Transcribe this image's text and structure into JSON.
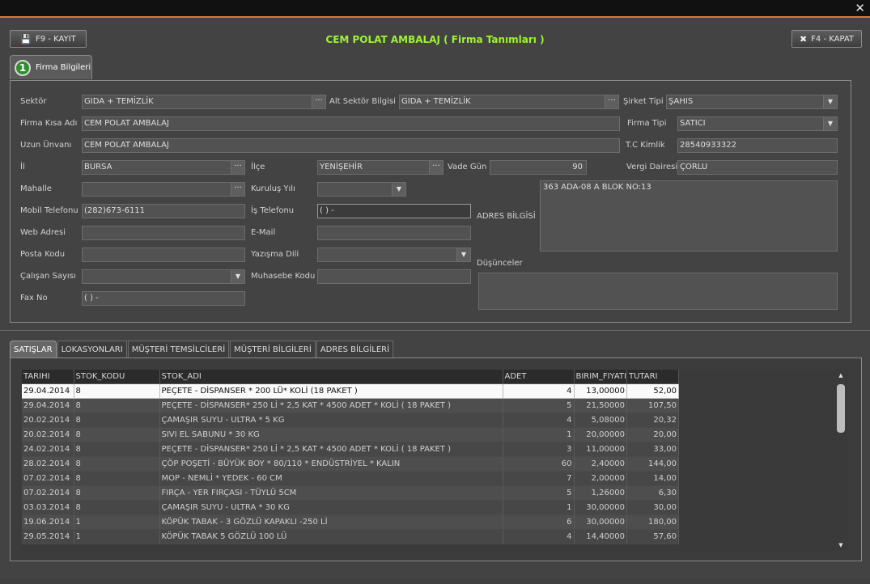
{
  "window": {
    "close_glyph": "✕"
  },
  "header": {
    "title": "CEM POLAT AMBALAJ  ( Firma Tanımları )",
    "save_label": "F9 - KAYIT",
    "close_label": "F4 - KAPAT",
    "tab_number": "1",
    "tab_label": "Firma Bilgileri"
  },
  "form": {
    "sektor_label": "Sektör",
    "sektor": "GIDA + TEMİZLİK",
    "alt_sektor_label": "Alt Sektör Bilgisi",
    "alt_sektor": "GIDA + TEMİZLİK",
    "sirket_tipi_label": "Şirket Tipi",
    "sirket_tipi": "ŞAHIS",
    "firma_kisa_label": "Firma Kısa Adı",
    "firma_kisa": "CEM POLAT AMBALAJ",
    "firma_tipi_label": "Firma Tipi",
    "firma_tipi": "SATICI",
    "uzun_unvan_label": "Uzun Ünvanı",
    "uzun_unvan": "CEM POLAT AMBALAJ",
    "tc_label": "T.C Kimlik",
    "tc": "28540933322",
    "il_label": "İl",
    "il": "BURSA",
    "ilce_label": "İlçe",
    "ilce": "YENİŞEHİR",
    "vade_label": "Vade Gün",
    "vade": "90",
    "vergi_label": "Vergi Dairesi",
    "vergi": "ÇORLU",
    "mahalle_label": "Mahalle",
    "mahalle": "",
    "kurulus_label": "Kuruluş Yılı",
    "kurulus": "",
    "mobil_label": "Mobil Telefonu",
    "mobil": "(282)673-6111",
    "is_tel_label": "İş Telefonu",
    "is_tel": "(   )    -",
    "adres_label": "ADRES BİLGİSİ",
    "adres": "363 ADA-08 A BLOK NO:13",
    "web_label": "Web Adresi",
    "web": "",
    "email_label": "E-Mail",
    "email": "",
    "posta_label": "Posta Kodu",
    "posta": "",
    "yazisma_label": "Yazışma Dili",
    "yazisma": "",
    "dusunce_label": "Düşünceler",
    "dusunce": "",
    "calisan_label": "Çalışan Sayısı",
    "calisan": "",
    "muhasebe_label": "Muhasebe Kodu",
    "muhasebe": "",
    "fax_label": "Fax No",
    "fax": "(   )    -"
  },
  "tabs": [
    "SATIŞLAR",
    "LOKASYONLARI",
    "MÜŞTERİ TEMSİLCİLERİ",
    "MÜŞTERİ BİLGİLERİ",
    "ADRES BİLGİLERİ"
  ],
  "grid": {
    "columns": [
      "TARIHI",
      "STOK_KODU",
      "STOK_ADI",
      "ADET",
      "BIRIM_FIYATI",
      "TUTARI"
    ],
    "rows": [
      [
        "29.04.2014",
        "8",
        "PEÇETE - DİSPANSER * 200 LÜ* KOLİ (18 PAKET )",
        "4",
        "13,00000",
        "52,00"
      ],
      [
        "29.04.2014",
        "8",
        "PEÇETE - DİSPANSER* 250 Lİ * 2,5 KAT * 4500 ADET * KOLİ ( 18 PAKET )",
        "5",
        "21,50000",
        "107,50"
      ],
      [
        "20.02.2014",
        "8",
        "ÇAMAŞIR SUYU - ULTRA * 5 KG",
        "4",
        "5,08000",
        "20,32"
      ],
      [
        "20.02.2014",
        "8",
        "SIVI EL SABUNU * 30 KG",
        "1",
        "20,00000",
        "20,00"
      ],
      [
        "24.02.2014",
        "8",
        "PEÇETE - DİSPANSER* 250 Lİ * 2,5 KAT * 4500 ADET * KOLİ ( 18 PAKET )",
        "3",
        "11,00000",
        "33,00"
      ],
      [
        "28.02.2014",
        "8",
        "ÇÖP POŞETİ - BÜYÜK BOY  * 80/110 * ENDÜSTRİYEL * KALIN",
        "60",
        "2,40000",
        "144,00"
      ],
      [
        "07.02.2014",
        "8",
        "MOP - NEMLİ * YEDEK - 60 CM",
        "7",
        "2,00000",
        "14,00"
      ],
      [
        "07.02.2014",
        "8",
        "FIRÇA - YER FIRÇASI - TÜYLÜ 5CM",
        "5",
        "1,26000",
        "6,30"
      ],
      [
        "03.03.2014",
        "8",
        "ÇAMAŞIR SUYU - ULTRA * 30 KG",
        "1",
        "30,00000",
        "30,00"
      ],
      [
        "19.06.2014",
        "1",
        "KÖPÜK TABAK - 3 GÖZLÜ KAPAKLI -250 Lİ",
        "6",
        "30,00000",
        "180,00"
      ],
      [
        "29.05.2014",
        "1",
        "KÖPÜK TABAK 5 GÖZLÜ 100 LÜ",
        "4",
        "14,40000",
        "57,60"
      ]
    ]
  }
}
